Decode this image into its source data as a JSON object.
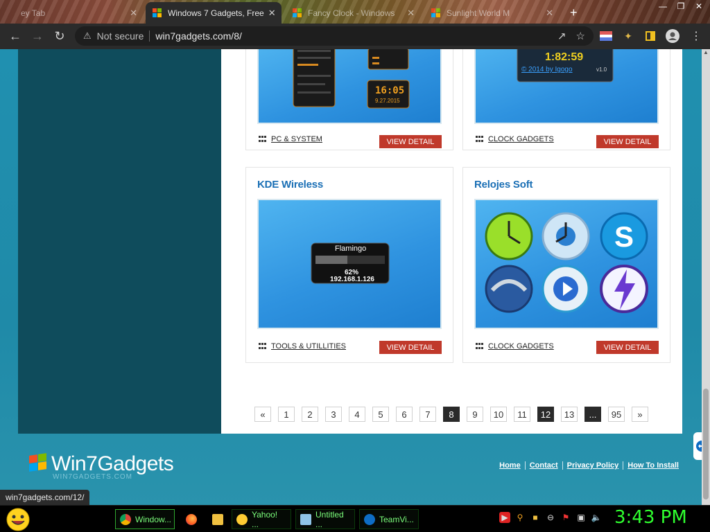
{
  "browser": {
    "tabs": [
      {
        "title": "ey Tab",
        "close": "✕"
      },
      {
        "title": "Windows 7 Gadgets, Free",
        "close": "✕"
      },
      {
        "title": "Fancy Clock - Windows",
        "close": "✕"
      },
      {
        "title": "Sunlight World M",
        "close": "✕"
      }
    ],
    "new_tab": "+",
    "security_label": "Not secure",
    "url": "win7gadgets.com/8/",
    "status_url": "win7gadgets.com/12/"
  },
  "page": {
    "top_cards": [
      {
        "category": "PC & SYSTEM",
        "button": "VIEW DETAIL",
        "screen_clock": "16:05",
        "screen_date": "9.27.2015"
      },
      {
        "category": "CLOCK GADGETS",
        "button": "VIEW DETAIL",
        "clock_time": "1:82:59",
        "credit": "© 2014 by Igogo",
        "version": "v1.0"
      }
    ],
    "cards": [
      {
        "title": "KDE Wireless",
        "category": "TOOLS & UTILLITIES",
        "button": "VIEW DETAIL",
        "widget_name": "Flamingo",
        "widget_percent": "62%",
        "widget_ip": "192.168.1.126"
      },
      {
        "title": "Relojes Soft",
        "category": "CLOCK GADGETS",
        "button": "VIEW DETAIL"
      }
    ],
    "pagination": [
      "«",
      "1",
      "2",
      "3",
      "4",
      "5",
      "6",
      "7",
      "8",
      "9",
      "10",
      "11",
      "12",
      "13",
      "...",
      "95",
      "»"
    ],
    "current_page": "8"
  },
  "footer": {
    "brand": "Win7Gadgets",
    "brand_sub": "WIN7GADGETS.COM",
    "links": [
      "Home",
      "Contact",
      "Privacy Policy",
      "How To Install"
    ]
  },
  "taskbar": {
    "items": [
      {
        "label": "Window..."
      },
      {
        "label": "Yahoo! ..."
      },
      {
        "label": "Untitled ..."
      },
      {
        "label": "TeamVi..."
      }
    ],
    "clock": "3:43 PM"
  }
}
